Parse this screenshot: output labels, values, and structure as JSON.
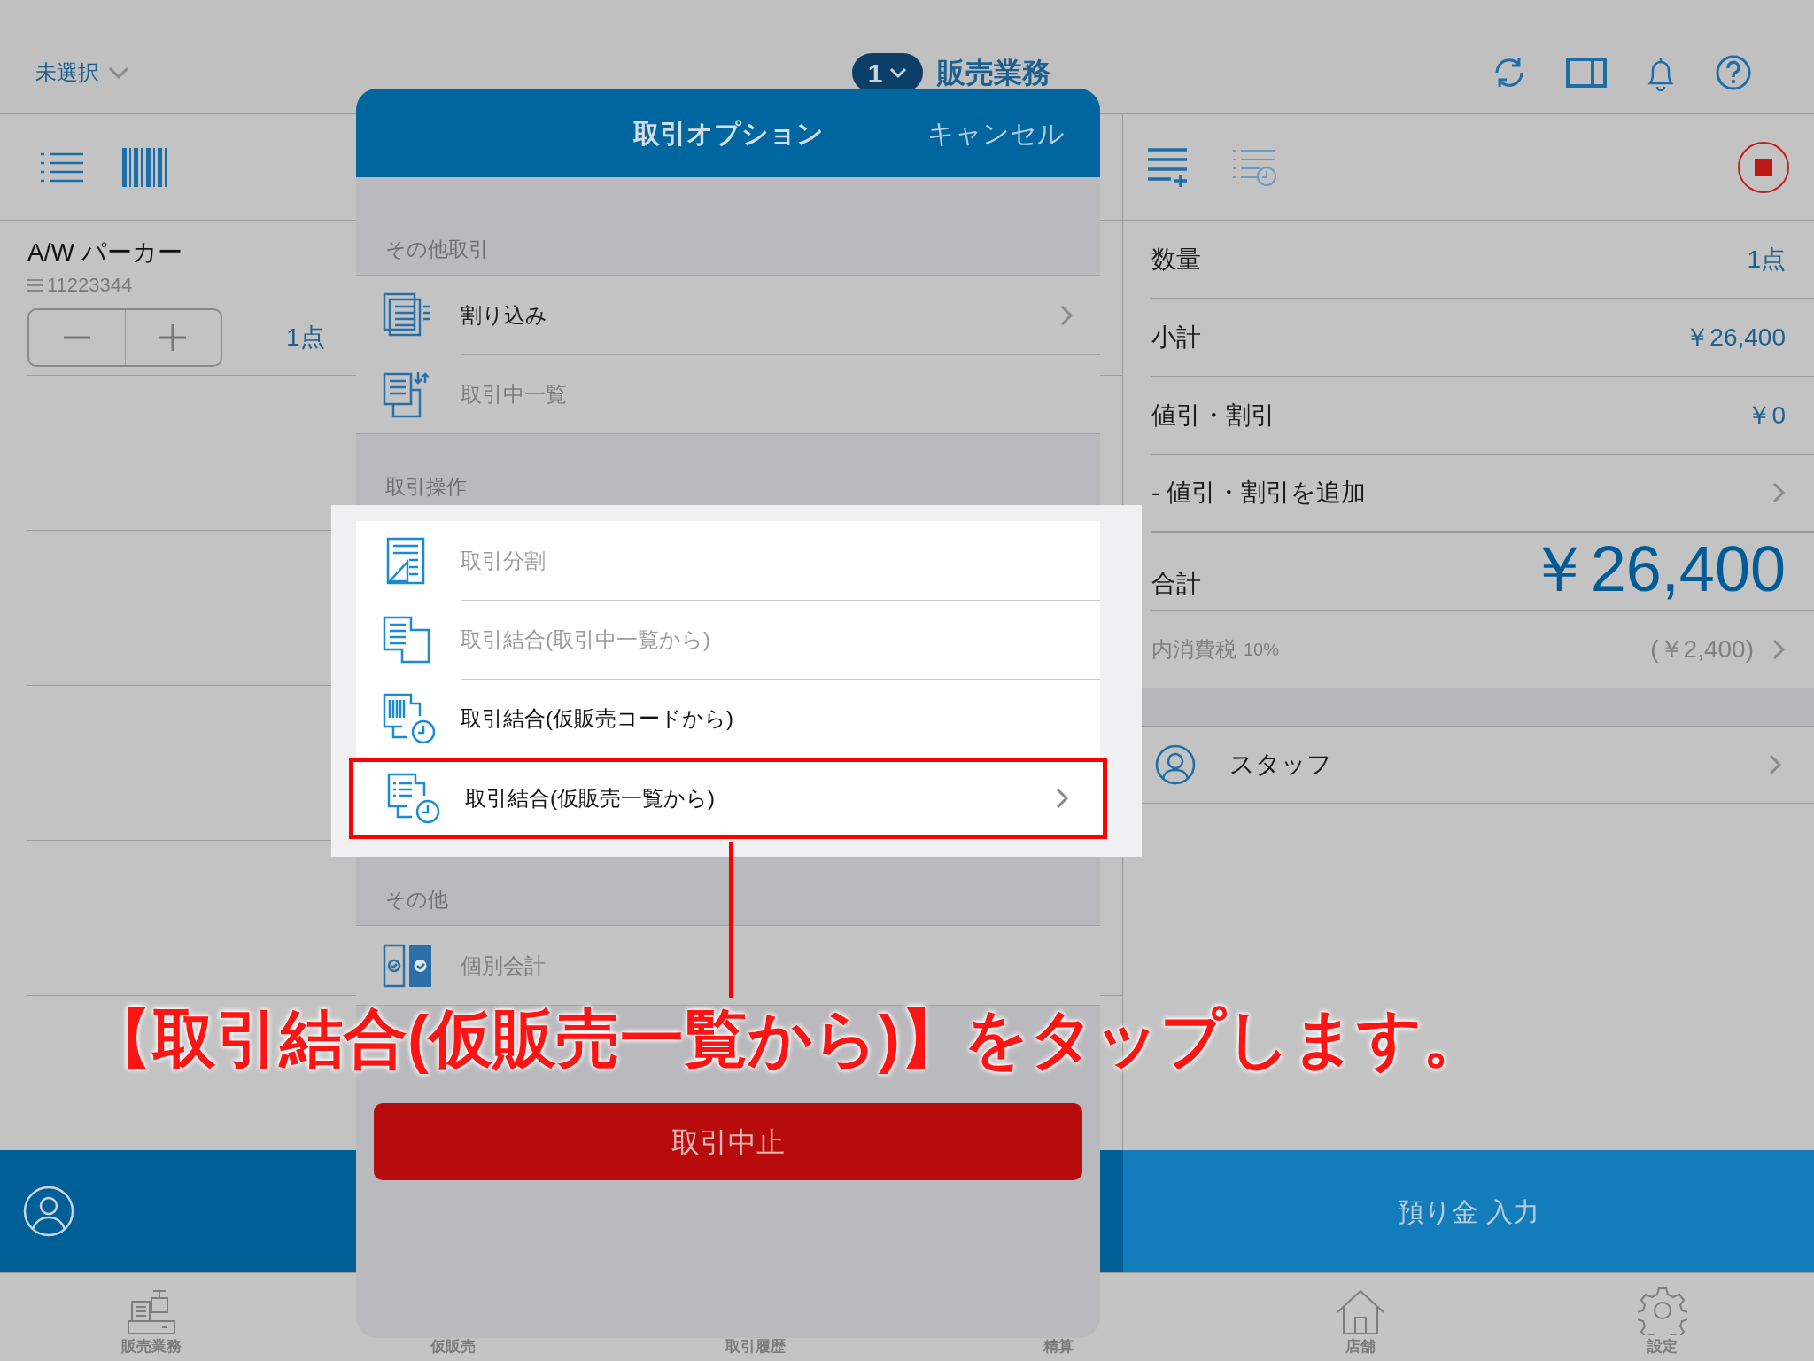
{
  "header": {
    "store_selector": "未選択",
    "register_number": "1",
    "title": "販売業務"
  },
  "cart": {
    "items": [
      {
        "name": "A/W パーカー",
        "code": "11223344",
        "quantity": "1点"
      }
    ]
  },
  "summary": {
    "rows": [
      {
        "kind": "line",
        "label": "数量",
        "value": "1点"
      },
      {
        "kind": "line",
        "label": "小計",
        "value": "￥26,400"
      },
      {
        "kind": "line",
        "label": "値引・割引",
        "value": "￥0"
      },
      {
        "kind": "link",
        "label": "- 値引・割引を追加"
      },
      {
        "kind": "total",
        "label": "合計",
        "value": "￥26,400"
      },
      {
        "kind": "tax",
        "label": "内消費税",
        "rate": "10%",
        "value": "(￥2,400)"
      }
    ],
    "staff": "スタッフ"
  },
  "deposit_button": "預り金 入力",
  "tab_bar": [
    "販売業務",
    "仮販売",
    "取引履歴",
    "精算",
    "店舗",
    "設定"
  ],
  "modal": {
    "title": "取引オプション",
    "cancel": "キャンセル",
    "sections": [
      {
        "heading": "その他取引",
        "highlighted": false,
        "items": [
          {
            "label": "割り込み",
            "disabled": false,
            "chevron": true,
            "highlighted": false
          },
          {
            "label": "取引中一覧",
            "disabled": true,
            "chevron": false,
            "highlighted": false
          }
        ]
      },
      {
        "heading": "取引操作",
        "highlighted": true,
        "items": [
          {
            "label": "取引分割",
            "disabled": true,
            "chevron": false,
            "highlighted": false
          },
          {
            "label": "取引結合(取引中一覧から)",
            "disabled": true,
            "chevron": false,
            "highlighted": false
          },
          {
            "label": "取引結合(仮販売コードから)",
            "disabled": false,
            "chevron": false,
            "highlighted": false
          },
          {
            "label": "取引結合(仮販売一覧から)",
            "disabled": false,
            "chevron": true,
            "highlighted": true
          }
        ]
      },
      {
        "heading": "その他",
        "highlighted": false,
        "items": [
          {
            "label": "個別会計",
            "disabled": true,
            "chevron": false,
            "highlighted": false
          }
        ]
      }
    ],
    "abort_button": "取引中止"
  },
  "annotation": "【取引結合(仮販売一覧から)】をタップします。"
}
